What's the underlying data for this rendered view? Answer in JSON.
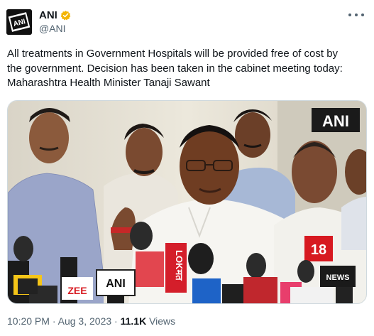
{
  "account": {
    "name": "ANI",
    "handle": "@ANI",
    "logo_text": "ANI"
  },
  "tweet": {
    "line1": "All treatments in Government Hospitals will be provided free of cost by",
    "line2": "the government. Decision has been taken in the cabinet meeting today:",
    "line3": "Maharashtra Health Minister Tanaji Sawant"
  },
  "media": {
    "watermark": "ANI",
    "mic_labels": [
      "LOKमत",
      "ANI",
      "ZEE",
      "18",
      "NEWS"
    ]
  },
  "meta": {
    "time": "10:20 PM",
    "separator": "·",
    "date": "Aug 3, 2023",
    "views_count": "11.1K",
    "views_label": "Views"
  },
  "colors": {
    "verified": "#f4b400",
    "secondary_text": "#536471",
    "primary_text": "#0f1419"
  }
}
